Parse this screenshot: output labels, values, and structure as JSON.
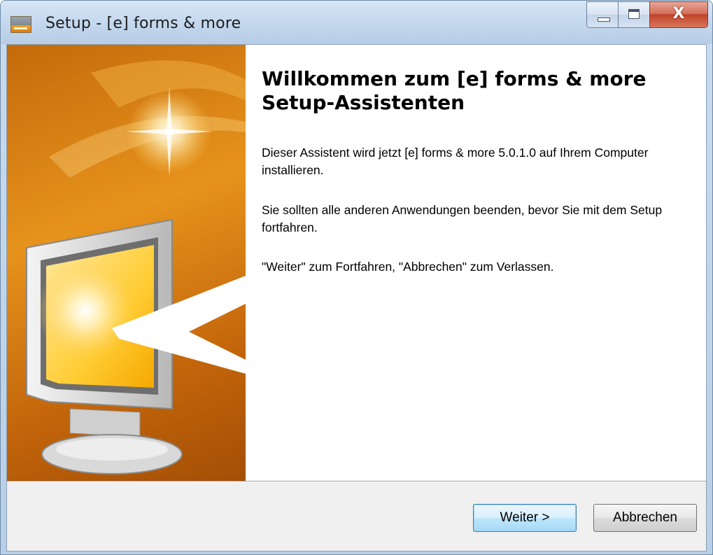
{
  "window": {
    "title": "Setup - [e] forms & more",
    "app_icon": "setup-app-icon"
  },
  "caption_buttons": {
    "minimize": "minimize-icon",
    "maximize": "maximize-icon",
    "close": "X"
  },
  "welcome": {
    "heading": "Willkommen zum [e] forms & more Setup-Assistenten",
    "paragraph1": "Dieser Assistent wird jetzt [e] forms & more 5.0.1.0 auf Ihrem Computer installieren.",
    "paragraph2": "Sie sollten alle anderen Anwendungen beenden, bevor Sie mit dem Setup fortfahren.",
    "paragraph3": "\"Weiter\" zum Fortfahren, \"Abbrechen\" zum Verlassen."
  },
  "buttons": {
    "next": "Weiter >",
    "cancel": "Abbrechen"
  },
  "colors": {
    "graphic_orange": "#e6931c",
    "graphic_dark": "#a34f06",
    "titlebar": "#c4d8ee",
    "close_red": "#c0442a"
  }
}
